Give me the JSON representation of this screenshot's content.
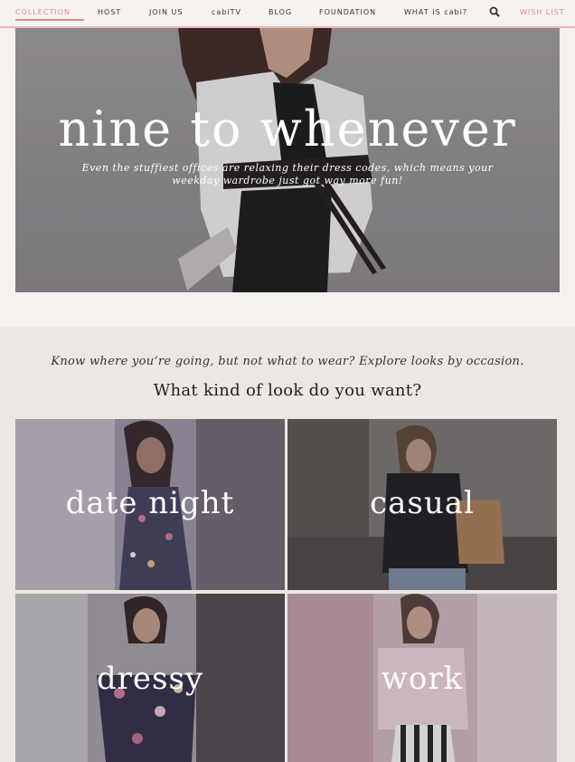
{
  "nav": {
    "items": [
      {
        "label": "COLLECTION",
        "active": true
      },
      {
        "label": "HOST"
      },
      {
        "label": "JOIN US"
      },
      {
        "label": "cabiTV"
      },
      {
        "label": "BLOG"
      },
      {
        "label": "FOUNDATION"
      },
      {
        "label": "WHAT IS cabi?"
      }
    ],
    "search_icon": "search-icon",
    "wishlist": "WISH LIST",
    "accent_color": "#e3848f"
  },
  "hero": {
    "title": "nine to whenever",
    "subtitle_line1": "Even the stuffiest offices are relaxing their dress codes, which means your",
    "subtitle_line2": "weekday wardrobe just got way more fun!"
  },
  "occasions": {
    "intro": "Know where you’re going, but not what to wear? Explore looks by occasion.",
    "question": "What kind of look do you want?",
    "tiles": [
      {
        "label": "date night"
      },
      {
        "label": "casual"
      },
      {
        "label": "dressy"
      },
      {
        "label": "work"
      }
    ]
  }
}
